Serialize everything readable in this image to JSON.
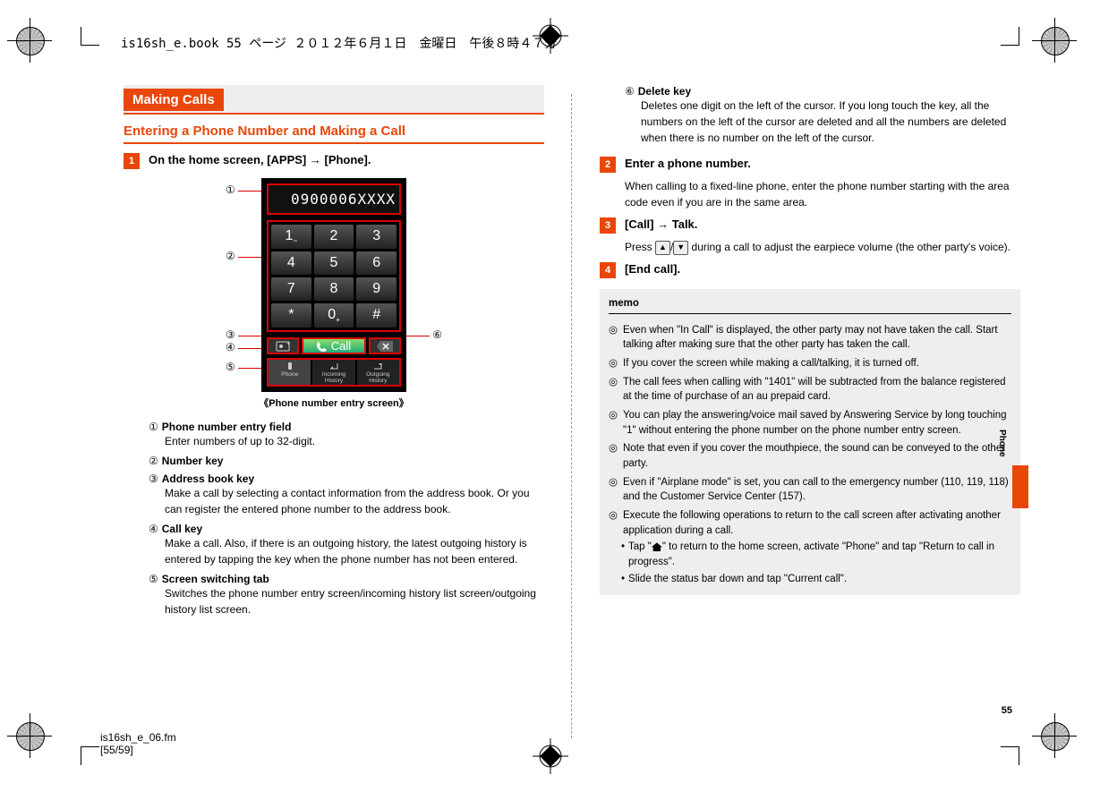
{
  "header_line": "is16sh_e.book  55 ページ  ２０１２年６月１日　金曜日　午後８時４７分",
  "column_left": {
    "section_title": "Making Calls",
    "subsection_title": "Entering a Phone Number and Making a Call",
    "step1": {
      "num": "1",
      "title_pre": "On the home screen, [APPS] ",
      "arrow": "→",
      "title_post": " [Phone]."
    },
    "phone": {
      "display": "0900006XXXX",
      "keys": [
        "1",
        "2",
        "3",
        "4",
        "5",
        "6",
        "7",
        "8",
        "9",
        "*",
        "0",
        "#"
      ],
      "zero_sub": "+",
      "one_sub": "~",
      "call_label": "Call",
      "tab_phone": "Phone",
      "tab_in": "Incoming History",
      "tab_out": "Outgoing History"
    },
    "caption": "《Phone number entry screen》",
    "items": {
      "i1": {
        "num": "①",
        "title": "Phone number entry field",
        "body": "Enter numbers of up to 32-digit."
      },
      "i2": {
        "num": "②",
        "title": "Number key"
      },
      "i3": {
        "num": "③",
        "title": "Address book key",
        "body": "Make a call by selecting a contact information from the address book. Or you can register the entered phone number to the address book."
      },
      "i4": {
        "num": "④",
        "title": "Call key",
        "body": "Make a call. Also, if there is an outgoing history, the latest outgoing history is entered by tapping the key when the phone number has not been entered."
      },
      "i5": {
        "num": "⑤",
        "title": "Screen switching tab",
        "body": "Switches the phone number entry screen/incoming history list screen/outgoing history list screen."
      }
    },
    "callouts": {
      "c1": "①",
      "c2": "②",
      "c3": "③",
      "c4": "④",
      "c5": "⑤",
      "c6": "⑥"
    }
  },
  "column_right": {
    "item6": {
      "num": "⑥",
      "title": "Delete key",
      "body": "Deletes one digit on the left of the cursor. If you long touch the key, all the numbers on the left of the cursor are deleted and all the numbers are deleted when there is no number on the left of the cursor."
    },
    "step2": {
      "num": "2",
      "title": "Enter a phone number.",
      "body": "When calling to a fixed-line phone, enter the phone number starting with the area code even if you are in the same area."
    },
    "step3": {
      "num": "3",
      "title_pre": "[Call] ",
      "arrow": "→",
      "title_post": " Talk.",
      "body_pre": "Press ",
      "key_up": "▲",
      "slash": "/",
      "key_down": "▼",
      "body_post": " during a call to adjust the earpiece volume (the other party's voice)."
    },
    "step4": {
      "num": "4",
      "title": "[End call]."
    },
    "memo": {
      "title": "memo",
      "b1": "Even when \"In Call\" is displayed, the other party may not have taken the call. Start talking after making sure that the other party has taken the call.",
      "b2": "If you cover the screen while making a call/talking, it is turned off.",
      "b3": "The call fees when calling with \"1401\" will be subtracted from the balance registered at the time of purchase of an au prepaid card.",
      "b4": "You can play the answering/voice mail saved by Answering Service by long touching \"1\" without entering the phone number on the phone number entry screen.",
      "b5": "Note that even if you cover the mouthpiece, the sound can be conveyed to the other party.",
      "b6": "Even if \"Airplane mode\" is set, you can call to the emergency number (110, 119, 118) and the Customer Service Center (157).",
      "b7": "Execute the following operations to return to the call screen after activating another application during a call.",
      "b7a_pre": "Tap \"",
      "b7a_post": "\" to return to the home screen, activate \"Phone\" and tap \"Return to call in progress\".",
      "b7b": "Slide the status bar down and tap \"Current call\"."
    }
  },
  "side_label": "Phone",
  "page_num": "55",
  "footer_line1": "is16sh_e_06.fm",
  "footer_line2": "[55/59]"
}
